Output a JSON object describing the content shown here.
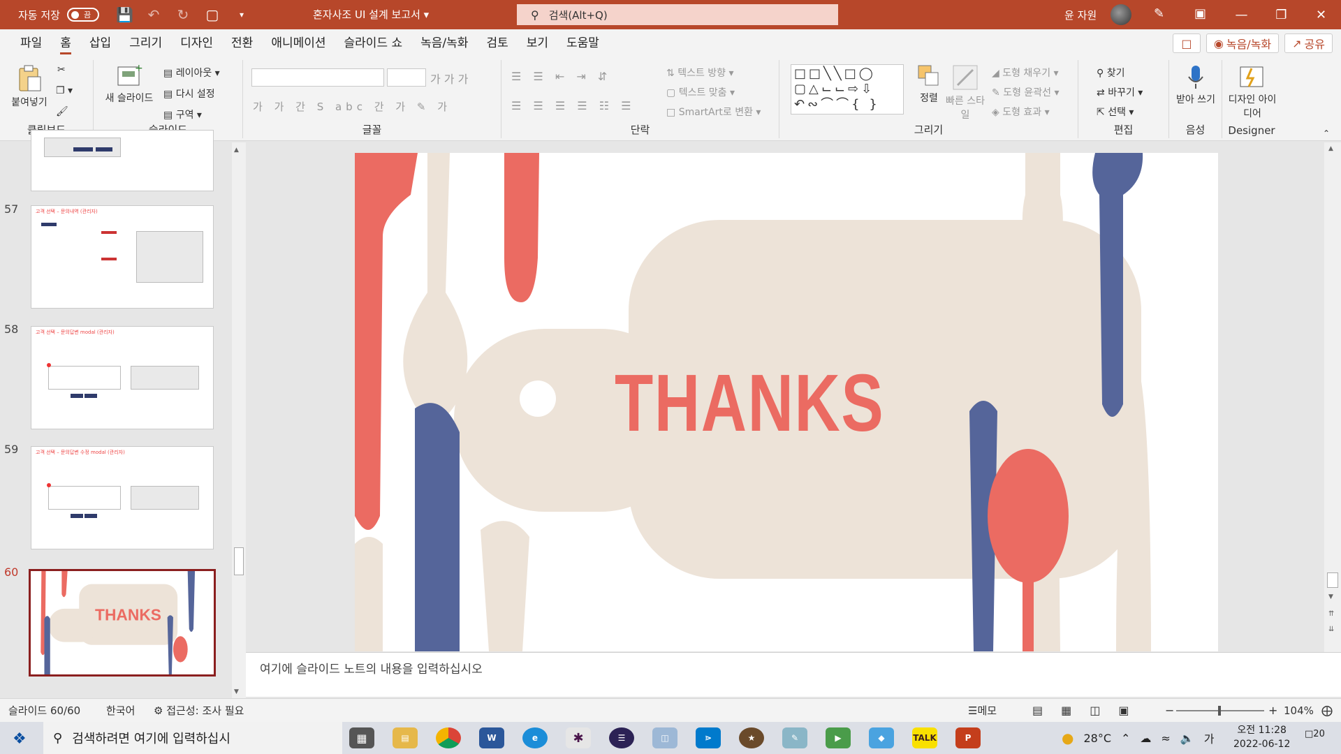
{
  "titlebar": {
    "autosave_label": "자동 저장",
    "autosave_state": "끔",
    "doc_title": "혼자사조 UI 설계 보고서 ▾",
    "search_placeholder": "검색(Alt+Q)",
    "user_name": "윤 자원"
  },
  "menu": {
    "tabs": [
      "파일",
      "홈",
      "삽입",
      "그리기",
      "디자인",
      "전환",
      "애니메이션",
      "슬라이드 쇼",
      "녹음/녹화",
      "검토",
      "보기",
      "도움말"
    ],
    "active_tab": "홈",
    "record_button": "녹음/녹화",
    "share_button": "공유"
  },
  "ribbon": {
    "clipboard": {
      "paste": "붙여넣기",
      "group": "클립보드"
    },
    "slides": {
      "new_slide": "새 슬라이드",
      "layout": "레이아웃",
      "reset": "다시 설정",
      "section": "구역",
      "group": "슬라이드"
    },
    "font": {
      "group": "글꼴"
    },
    "paragraph": {
      "text_direction": "텍스트 방향",
      "align_text": "텍스트 맞춤",
      "smartart": "SmartArt로 변환",
      "group": "단락"
    },
    "drawing": {
      "arrange": "정렬",
      "quick_styles": "빠른 스타일",
      "fill": "도형 채우기",
      "outline": "도형 윤곽선",
      "effects": "도형 효과",
      "group": "그리기"
    },
    "editing": {
      "find": "찾기",
      "replace": "바꾸기",
      "select": "선택",
      "group": "편집"
    },
    "voice": {
      "dictate": "받아 쓰기",
      "group": "음성"
    },
    "designer": {
      "ideas": "디자인 아이디어",
      "group": "Designer"
    }
  },
  "slides_panel": {
    "items": [
      {
        "number": "57",
        "title": "고객 선택 – 문의내역 (관리자)"
      },
      {
        "number": "58",
        "title": "고객 선택 – 문의답변 modal (관리자)"
      },
      {
        "number": "59",
        "title": "고객 선택 – 문의답변 수정 modal (관리자)"
      },
      {
        "number": "60",
        "title": "THANKS"
      }
    ],
    "active": "60"
  },
  "slide": {
    "headline": "THANKS"
  },
  "notes": {
    "placeholder": "여기에 슬라이드 노트의 내용을 입력하십시오"
  },
  "statusbar": {
    "slide_count": "슬라이드 60/60",
    "language": "한국어",
    "accessibility": "접근성: 조사 필요",
    "notes_button": "메모",
    "zoom": "104%"
  },
  "taskbar": {
    "search_placeholder": "검색하려면 여기에 입력하십시",
    "weather": "28°C",
    "ime": "가",
    "time_period": "오전 11:28",
    "date": "2022-06-12",
    "notifications": "20"
  },
  "colors": {
    "accent": "#b7472a",
    "slide_red": "#eb6b62",
    "slide_blue": "#55659a",
    "slide_beige": "#ede3d8"
  }
}
